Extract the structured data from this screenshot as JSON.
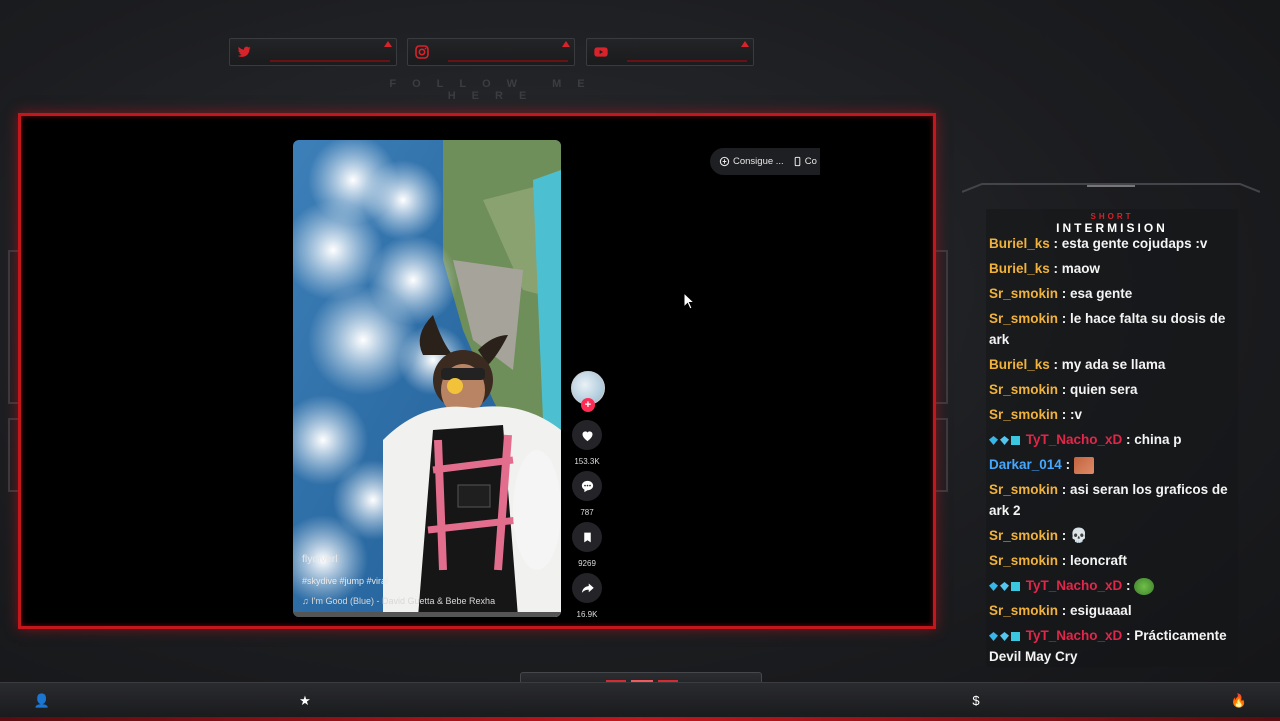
{
  "overlay": {
    "social": [
      {
        "icon": "twitter-icon"
      },
      {
        "icon": "instagram-icon"
      },
      {
        "icon": "youtube-icon"
      }
    ],
    "follow_text": "FOLLOW ME HERE",
    "accent_color": "#c3161d"
  },
  "tiktok": {
    "username": "flydiverl",
    "hashtags": "#skydive #jump #viral",
    "music": "I'm Good (Blue) - David Guetta & Bebe Rexha",
    "likes": "153.3K",
    "comments": "787",
    "saves": "9269",
    "shares": "16.9K",
    "pill_label_1": "Consigue ...",
    "pill_label_2": "Co"
  },
  "chat": {
    "header_small": "SHORT",
    "header_big": "INTERMISION",
    "messages": [
      {
        "user": "Buriel_ks",
        "text": "esta gente cojudaps :v"
      },
      {
        "user": "Buriel_ks",
        "text": "maow"
      },
      {
        "user": "Sr_smokin",
        "text": "esa gente"
      },
      {
        "user": "Sr_smokin",
        "text": "le hace falta su dosis de ark"
      },
      {
        "user": "Buriel_ks",
        "text": "my ada se llama"
      },
      {
        "user": "Sr_smokin",
        "text": "quien sera"
      },
      {
        "user": "Sr_smokin",
        "text": ":v"
      },
      {
        "user": "TyT_Nacho_xD",
        "text": "china p"
      },
      {
        "user": "Darkar_014",
        "text": ""
      },
      {
        "user": "Sr_smokin",
        "text": "asi seran los graficos de ark 2"
      },
      {
        "user": "Sr_smokin",
        "text": ""
      },
      {
        "user": "Sr_smokin",
        "text": "leoncraft"
      },
      {
        "user": "TyT_Nacho_xD",
        "text": ""
      },
      {
        "user": "Sr_smokin",
        "text": "esiguaaal"
      },
      {
        "user": "TyT_Nacho_xD",
        "text": "Prácticamente Devil May Cry"
      }
    ],
    "separator": " : "
  },
  "bottom_icons": [
    "user-icon",
    "star-icon",
    "dollar-icon",
    "drop-icon"
  ],
  "bottom_glyphs": [
    "👤",
    "★",
    "$",
    "🔥"
  ]
}
